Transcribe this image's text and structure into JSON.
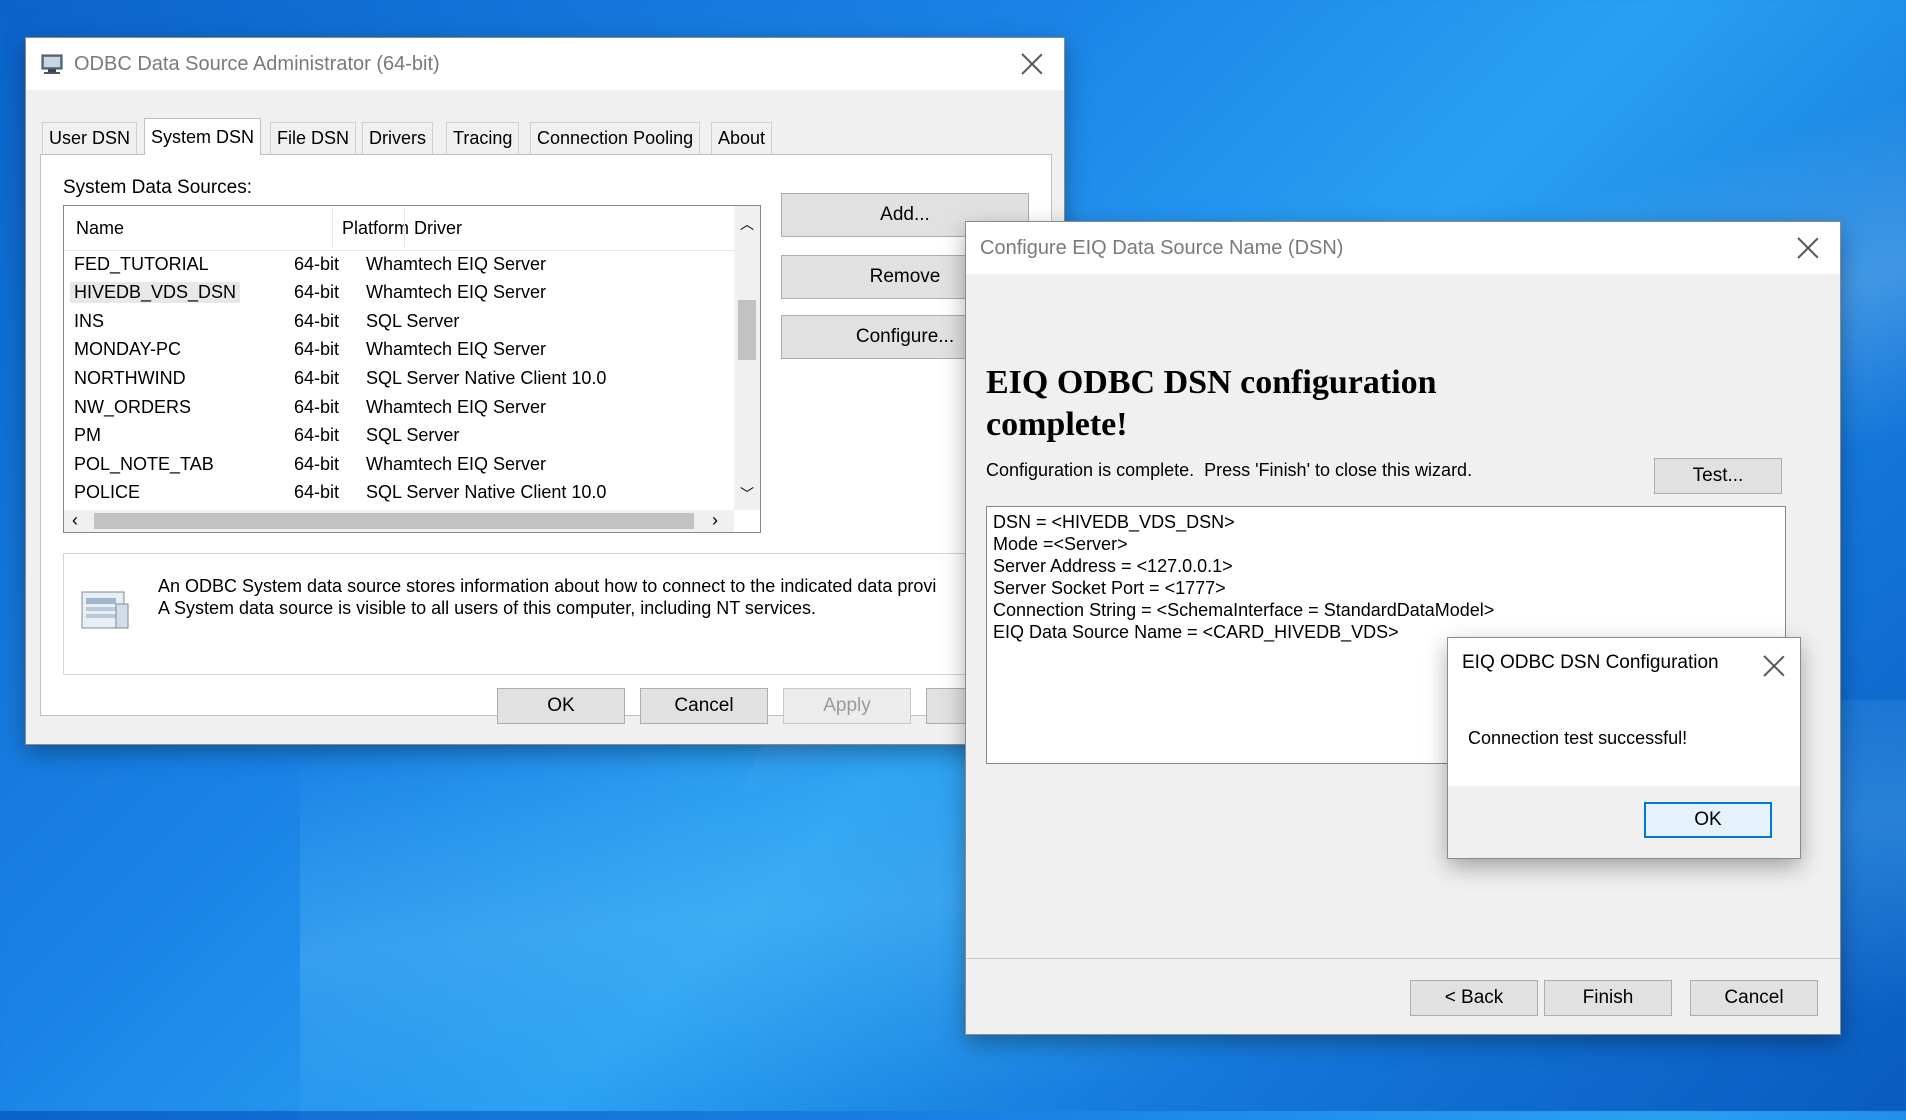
{
  "odbc_admin": {
    "title": "ODBC Data Source Administrator (64-bit)",
    "tabs": [
      "User DSN",
      "System DSN",
      "File DSN",
      "Drivers",
      "Tracing",
      "Connection Pooling",
      "About"
    ],
    "active_tab": "System DSN",
    "section_label": "System Data Sources:",
    "columns": {
      "name": "Name",
      "platform": "Platform",
      "driver": "Driver"
    },
    "rows": [
      {
        "name": "FED_TUTORIAL",
        "platform": "64-bit",
        "driver": "Whamtech EIQ Server"
      },
      {
        "name": "HIVEDB_VDS_DSN",
        "platform": "64-bit",
        "driver": "Whamtech EIQ Server"
      },
      {
        "name": "INS",
        "platform": "64-bit",
        "driver": "SQL Server"
      },
      {
        "name": "MONDAY-PC",
        "platform": "64-bit",
        "driver": "Whamtech EIQ Server"
      },
      {
        "name": "NORTHWIND",
        "platform": "64-bit",
        "driver": "SQL Server Native Client 10.0"
      },
      {
        "name": "NW_ORDERS",
        "platform": "64-bit",
        "driver": "Whamtech EIQ Server"
      },
      {
        "name": "PM",
        "platform": "64-bit",
        "driver": "SQL Server"
      },
      {
        "name": "POL_NOTE_TAB",
        "platform": "64-bit",
        "driver": "Whamtech EIQ Server"
      },
      {
        "name": "POLICE",
        "platform": "64-bit",
        "driver": "SQL Server Native Client 10.0"
      }
    ],
    "buttons": {
      "add": "Add...",
      "remove": "Remove",
      "configure": "Configure..."
    },
    "info_line1": "An ODBC System data source stores information about how to connect to the indicated data provi",
    "info_line2": "A System data source is visible to all users of this computer, including NT services.",
    "footer": {
      "ok": "OK",
      "cancel": "Cancel",
      "apply": "Apply"
    }
  },
  "config_wizard": {
    "title": "Configure EIQ Data Source Name (DSN)",
    "heading_line1": "EIQ ODBC DSN configuration",
    "heading_line2": "complete!",
    "message": "Configuration is complete.  Press 'Finish' to close this wizard.",
    "test_button": "Test...",
    "summary": [
      "DSN = <HIVEDB_VDS_DSN>",
      "Mode =<Server>",
      "Server Address = <127.0.0.1>",
      "Server Socket Port = <1777>",
      "Connection String = <SchemaInterface = StandardDataModel>",
      "EIQ Data Source Name = <CARD_HIVEDB_VDS>"
    ],
    "footer": {
      "back": "< Back",
      "finish": "Finish",
      "cancel": "Cancel"
    }
  },
  "message_box": {
    "title": "EIQ ODBC DSN Configuration",
    "message": "Connection test successful!",
    "ok": "OK"
  }
}
